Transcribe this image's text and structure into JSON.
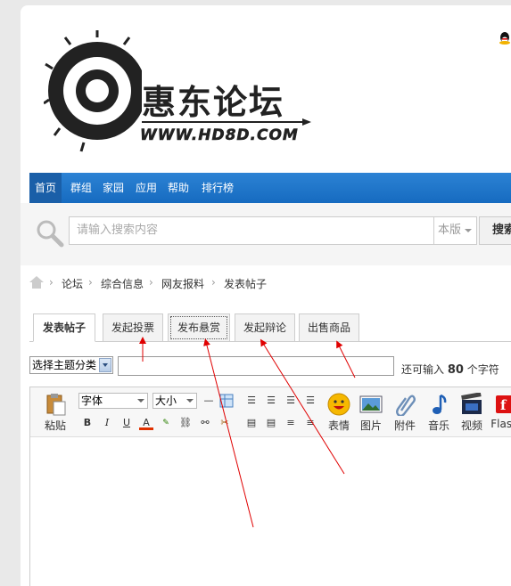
{
  "brand": {
    "logo_name": "惠东论坛",
    "logo_url": "WWW.HD8D.COM"
  },
  "nav": {
    "items": [
      "首页",
      "群组",
      "家园",
      "应用",
      "帮助",
      "排行榜"
    ]
  },
  "search": {
    "placeholder": "请输入搜索内容",
    "scope": "本版",
    "button": "搜索"
  },
  "breadcrumb": [
    "论坛",
    "综合信息",
    "网友报料",
    "发表帖子"
  ],
  "tabs": [
    {
      "label": "发表帖子"
    },
    {
      "label": "发起投票"
    },
    {
      "label": "发布悬赏"
    },
    {
      "label": "发起辩论"
    },
    {
      "label": "出售商品"
    }
  ],
  "post": {
    "type_select": "选择主题分类",
    "hint_prefix": "还可输入",
    "hint_count": "80",
    "hint_suffix": "个字符"
  },
  "toolbar": {
    "paste": "粘贴",
    "font": "字体",
    "size": "大小",
    "emoji": "表情",
    "image": "图片",
    "attach": "附件",
    "music": "音乐",
    "video": "视频",
    "flash": "Flash"
  },
  "colors": {
    "nav_blue": "#1f75c9",
    "annotation_red": "#e00000"
  }
}
